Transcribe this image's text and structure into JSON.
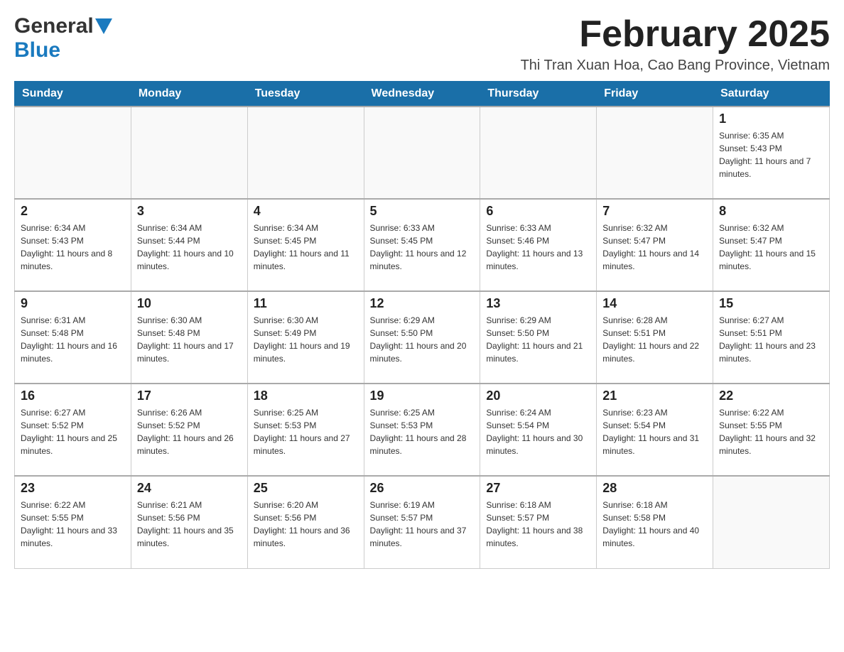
{
  "header": {
    "logo_general": "General",
    "logo_blue": "Blue",
    "month_title": "February 2025",
    "location": "Thi Tran Xuan Hoa, Cao Bang Province, Vietnam"
  },
  "days_of_week": [
    "Sunday",
    "Monday",
    "Tuesday",
    "Wednesday",
    "Thursday",
    "Friday",
    "Saturday"
  ],
  "weeks": [
    [
      {
        "day": "",
        "info": ""
      },
      {
        "day": "",
        "info": ""
      },
      {
        "day": "",
        "info": ""
      },
      {
        "day": "",
        "info": ""
      },
      {
        "day": "",
        "info": ""
      },
      {
        "day": "",
        "info": ""
      },
      {
        "day": "1",
        "info": "Sunrise: 6:35 AM\nSunset: 5:43 PM\nDaylight: 11 hours and 7 minutes."
      }
    ],
    [
      {
        "day": "2",
        "info": "Sunrise: 6:34 AM\nSunset: 5:43 PM\nDaylight: 11 hours and 8 minutes."
      },
      {
        "day": "3",
        "info": "Sunrise: 6:34 AM\nSunset: 5:44 PM\nDaylight: 11 hours and 10 minutes."
      },
      {
        "day": "4",
        "info": "Sunrise: 6:34 AM\nSunset: 5:45 PM\nDaylight: 11 hours and 11 minutes."
      },
      {
        "day": "5",
        "info": "Sunrise: 6:33 AM\nSunset: 5:45 PM\nDaylight: 11 hours and 12 minutes."
      },
      {
        "day": "6",
        "info": "Sunrise: 6:33 AM\nSunset: 5:46 PM\nDaylight: 11 hours and 13 minutes."
      },
      {
        "day": "7",
        "info": "Sunrise: 6:32 AM\nSunset: 5:47 PM\nDaylight: 11 hours and 14 minutes."
      },
      {
        "day": "8",
        "info": "Sunrise: 6:32 AM\nSunset: 5:47 PM\nDaylight: 11 hours and 15 minutes."
      }
    ],
    [
      {
        "day": "9",
        "info": "Sunrise: 6:31 AM\nSunset: 5:48 PM\nDaylight: 11 hours and 16 minutes."
      },
      {
        "day": "10",
        "info": "Sunrise: 6:30 AM\nSunset: 5:48 PM\nDaylight: 11 hours and 17 minutes."
      },
      {
        "day": "11",
        "info": "Sunrise: 6:30 AM\nSunset: 5:49 PM\nDaylight: 11 hours and 19 minutes."
      },
      {
        "day": "12",
        "info": "Sunrise: 6:29 AM\nSunset: 5:50 PM\nDaylight: 11 hours and 20 minutes."
      },
      {
        "day": "13",
        "info": "Sunrise: 6:29 AM\nSunset: 5:50 PM\nDaylight: 11 hours and 21 minutes."
      },
      {
        "day": "14",
        "info": "Sunrise: 6:28 AM\nSunset: 5:51 PM\nDaylight: 11 hours and 22 minutes."
      },
      {
        "day": "15",
        "info": "Sunrise: 6:27 AM\nSunset: 5:51 PM\nDaylight: 11 hours and 23 minutes."
      }
    ],
    [
      {
        "day": "16",
        "info": "Sunrise: 6:27 AM\nSunset: 5:52 PM\nDaylight: 11 hours and 25 minutes."
      },
      {
        "day": "17",
        "info": "Sunrise: 6:26 AM\nSunset: 5:52 PM\nDaylight: 11 hours and 26 minutes."
      },
      {
        "day": "18",
        "info": "Sunrise: 6:25 AM\nSunset: 5:53 PM\nDaylight: 11 hours and 27 minutes."
      },
      {
        "day": "19",
        "info": "Sunrise: 6:25 AM\nSunset: 5:53 PM\nDaylight: 11 hours and 28 minutes."
      },
      {
        "day": "20",
        "info": "Sunrise: 6:24 AM\nSunset: 5:54 PM\nDaylight: 11 hours and 30 minutes."
      },
      {
        "day": "21",
        "info": "Sunrise: 6:23 AM\nSunset: 5:54 PM\nDaylight: 11 hours and 31 minutes."
      },
      {
        "day": "22",
        "info": "Sunrise: 6:22 AM\nSunset: 5:55 PM\nDaylight: 11 hours and 32 minutes."
      }
    ],
    [
      {
        "day": "23",
        "info": "Sunrise: 6:22 AM\nSunset: 5:55 PM\nDaylight: 11 hours and 33 minutes."
      },
      {
        "day": "24",
        "info": "Sunrise: 6:21 AM\nSunset: 5:56 PM\nDaylight: 11 hours and 35 minutes."
      },
      {
        "day": "25",
        "info": "Sunrise: 6:20 AM\nSunset: 5:56 PM\nDaylight: 11 hours and 36 minutes."
      },
      {
        "day": "26",
        "info": "Sunrise: 6:19 AM\nSunset: 5:57 PM\nDaylight: 11 hours and 37 minutes."
      },
      {
        "day": "27",
        "info": "Sunrise: 6:18 AM\nSunset: 5:57 PM\nDaylight: 11 hours and 38 minutes."
      },
      {
        "day": "28",
        "info": "Sunrise: 6:18 AM\nSunset: 5:58 PM\nDaylight: 11 hours and 40 minutes."
      },
      {
        "day": "",
        "info": ""
      }
    ]
  ]
}
